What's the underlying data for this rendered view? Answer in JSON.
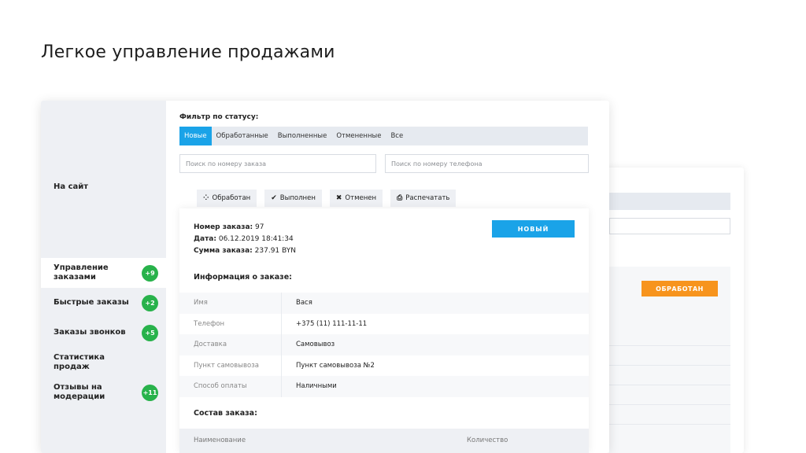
{
  "headline": "Легкое управление продажами",
  "back_card": {
    "status_badge": "ОБРАБОТАН"
  },
  "sidebar": {
    "to_site": "На сайт",
    "items": [
      {
        "label": "Управление заказами",
        "count": "+9",
        "active": true
      },
      {
        "label": "Быстрые заказы",
        "count": "+2"
      },
      {
        "label": "Заказы звонков",
        "count": "+5"
      },
      {
        "label": "Статистика продаж",
        "count": ""
      },
      {
        "label": "Отзывы на модерации",
        "count": "+11"
      }
    ]
  },
  "filter": {
    "title": "Фильтр по статусу:",
    "tabs": [
      "Новые",
      "Обработанные",
      "Выполненные",
      "Отмененные",
      "Все"
    ],
    "active_tab": "Новые"
  },
  "search": {
    "order_placeholder": "Поиск по номеру заказа",
    "phone_placeholder": "Поиск по номеру телефона"
  },
  "actions": {
    "processed": "Обработан",
    "done": "Выполнен",
    "cancelled": "Отменен",
    "print": "Распечатать"
  },
  "order": {
    "number_label": "Номер заказа:",
    "number": "97",
    "date_label": "Дата:",
    "date": "06.12.2019 18:41:34",
    "sum_label": "Сумма заказа:",
    "sum": "237.91 BYN",
    "status": "НОВЫЙ",
    "info_title": "Информация о заказе:",
    "info": [
      {
        "key": "Имя",
        "value": "Вася"
      },
      {
        "key": "Телефон",
        "value": "+375 (11) 111-11-11"
      },
      {
        "key": "Доставка",
        "value": "Самовывоз"
      },
      {
        "key": "Пункт самовывоза",
        "value": "Пункт самовывоза №2"
      },
      {
        "key": "Способ оплаты",
        "value": "Наличными"
      }
    ],
    "items_title": "Состав заказа:",
    "items_head": {
      "name": "Наименование",
      "qty": "Количество"
    }
  },
  "colors": {
    "accent": "#1aa3e8",
    "badge_green": "#28b24b",
    "orange": "#f7941d"
  },
  "icons": {
    "processed": "spinner-icon",
    "done": "check-icon",
    "cancelled": "close-icon",
    "print": "printer-icon"
  }
}
